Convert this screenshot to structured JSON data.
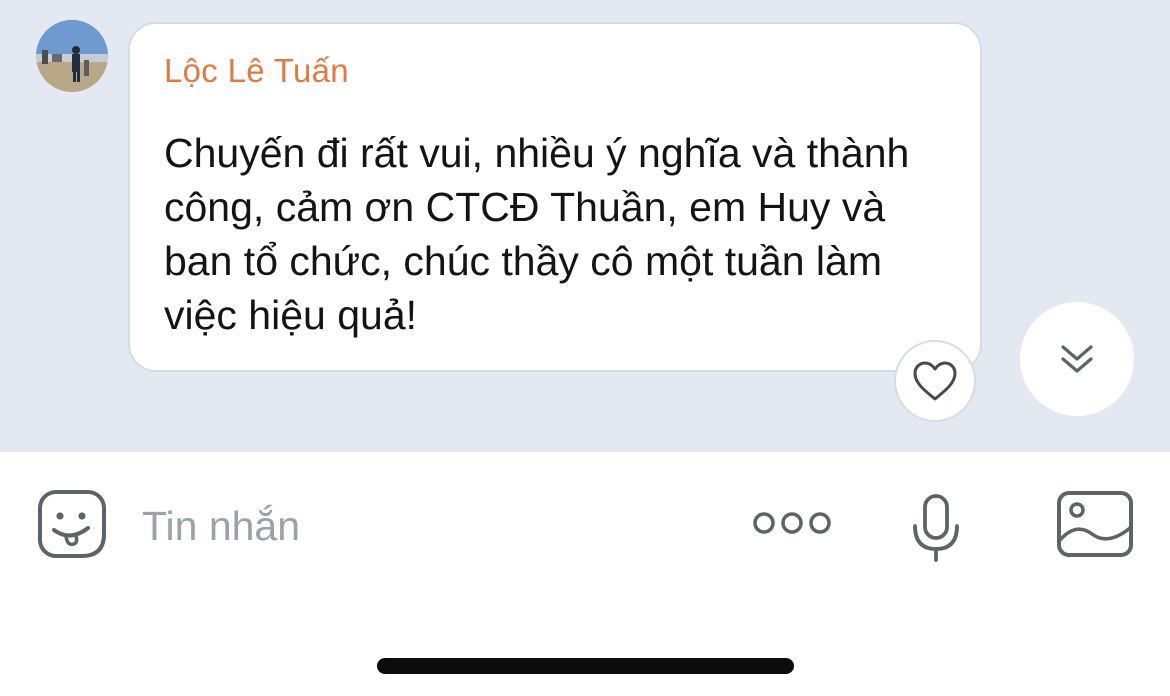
{
  "message": {
    "sender": "Lộc Lê Tuấn",
    "text": "Chuyến đi rất vui, nhiều ý nghĩa và thành công, cảm ơn CTCĐ Thuần, em Huy và ban tổ chức, chúc thầy cô một tuần làm việc hiệu quả!",
    "avatar_icon": "user-photo-avatar",
    "reaction_icon": "heart-icon"
  },
  "scroll_button": {
    "icon": "double-chevron-down-icon"
  },
  "composer": {
    "placeholder": "Tin nhắn",
    "value": "",
    "emoji_icon": "sticker-smile-icon",
    "more_icon": "more-dots-icon",
    "mic_icon": "microphone-icon",
    "image_icon": "image-gallery-icon"
  },
  "colors": {
    "chat_background": "#e4e9f1",
    "sender_name": "#e07a45",
    "placeholder": "#9aa1aa",
    "icon_gray": "#5f6368"
  }
}
